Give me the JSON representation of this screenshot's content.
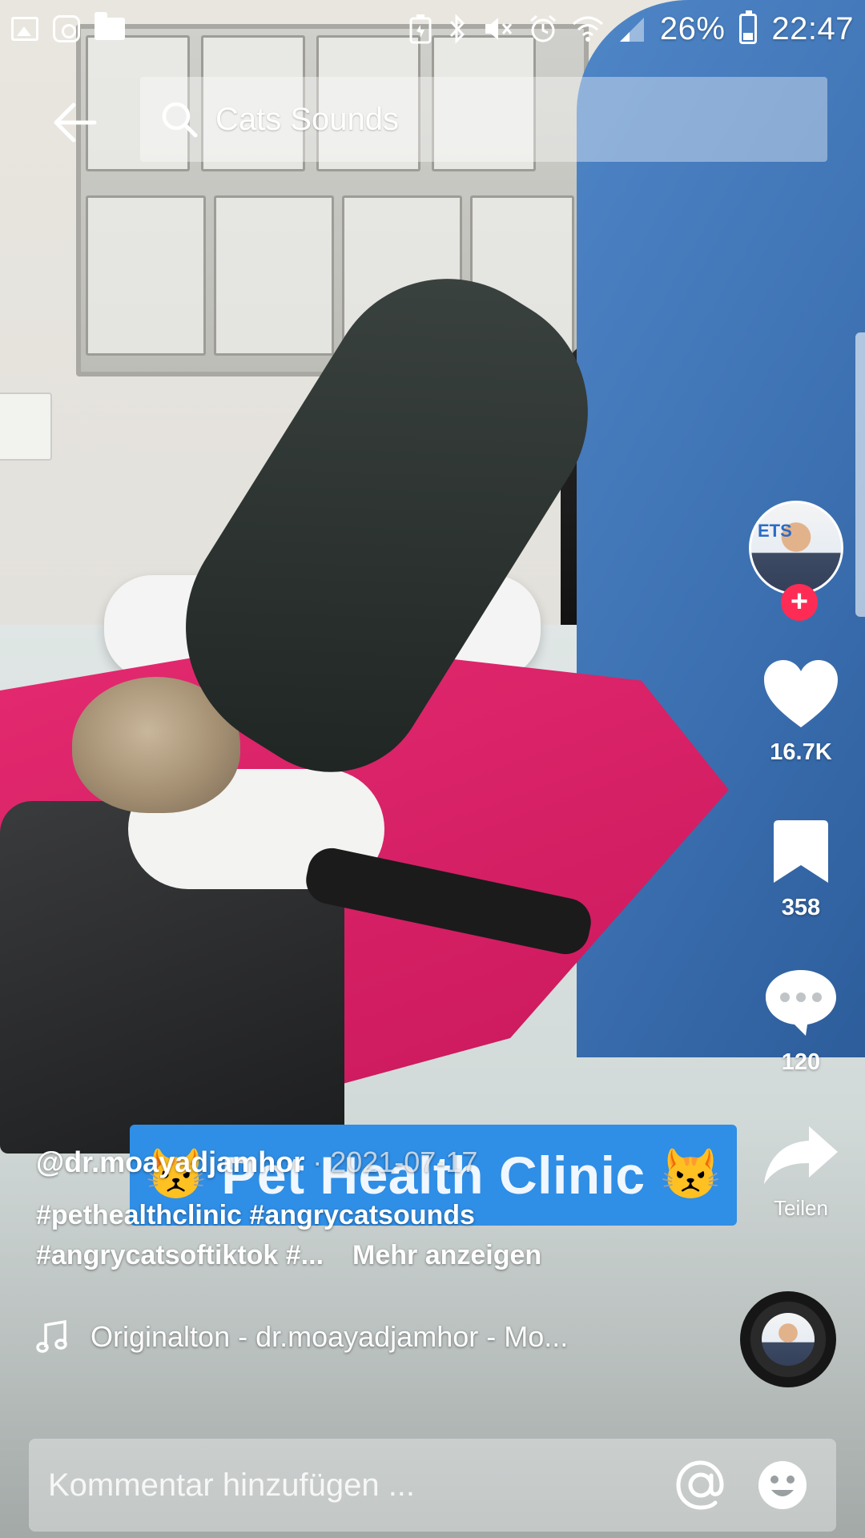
{
  "status_bar": {
    "left_icons": [
      "gallery-icon",
      "instagram-icon",
      "folder-icon"
    ],
    "right_icons": [
      "battery-saver-icon",
      "bluetooth-icon",
      "mute-icon",
      "alarm-icon",
      "wifi-icon",
      "signal-icon"
    ],
    "battery_percent": "26%",
    "time": "22:47"
  },
  "search": {
    "back_icon": "arrow-left-icon",
    "icon": "search-icon",
    "query": "Cats Sounds"
  },
  "actions": {
    "likes": "16.7K",
    "bookmarks": "358",
    "comments": "120",
    "share_label": "Teilen",
    "follow_icon": "plus-icon",
    "avatar_letters": "ETS"
  },
  "video": {
    "banner_text": "Pet Health Clinic",
    "banner_emoji_left": "😾",
    "banner_emoji_right": "😾"
  },
  "meta": {
    "author": "@dr.moayadjamhor",
    "separator": " · ",
    "date": "2021-07-17",
    "hashtags_line1": "#pethealthclinic #angrycatsounds",
    "hashtags_line2": "#angrycatsoftiktok #...",
    "more_label": "Mehr anzeigen",
    "music": "Originalton - dr.moayadjamhor - Mo..."
  },
  "comment": {
    "placeholder": "Kommentar hinzufügen ...",
    "mention_icon": "at-icon",
    "emoji_icon": "emoji-icon"
  },
  "colors": {
    "like_red": "#fe2c55",
    "banner_blue": "#2f8ee6",
    "scrubs_blue": "#3b6fb0"
  }
}
